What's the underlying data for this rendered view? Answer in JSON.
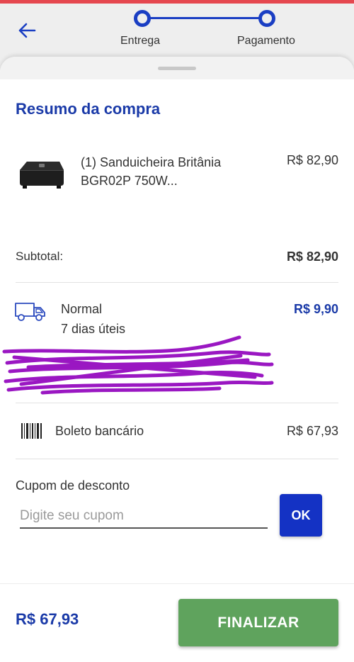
{
  "colors": {
    "accent_blue": "#1a3aa8",
    "ok_button": "#1432c4",
    "finalize_button": "#5fa35d",
    "top_strip": "#e5474f",
    "scribble": "#9a17c2"
  },
  "header": {
    "back_icon": "arrow-left-icon",
    "steps": [
      {
        "label": "Entrega"
      },
      {
        "label": "Pagamento"
      }
    ]
  },
  "summary": {
    "title": "Resumo da compra",
    "product": {
      "name": "(1) Sanduicheira Britânia BGR02P 750W...",
      "price": "R$ 82,90"
    },
    "subtotal": {
      "label": "Subtotal:",
      "value": "R$ 82,90"
    },
    "shipping": {
      "icon": "truck-icon",
      "name": "Normal",
      "days": "7 dias úteis",
      "price": "R$ 9,90"
    },
    "payment": {
      "icon": "barcode-icon",
      "method": "Boleto bancário",
      "value": "R$ 67,93"
    },
    "coupon": {
      "label": "Cupom de desconto",
      "placeholder": "Digite seu cupom",
      "button": "OK"
    }
  },
  "footer": {
    "total": "R$ 67,93",
    "finalize": "FINALIZAR"
  }
}
